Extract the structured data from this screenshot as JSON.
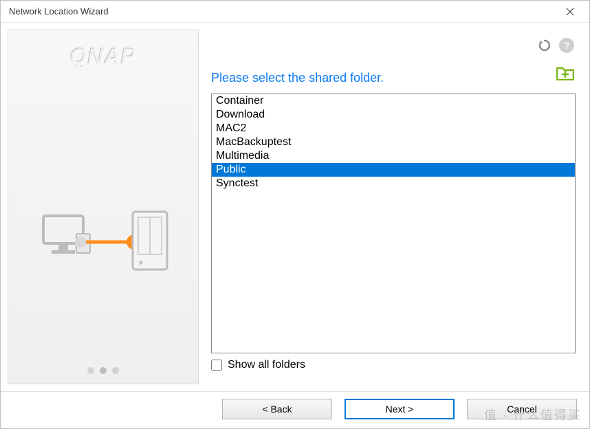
{
  "window": {
    "title": "Network Location Wizard"
  },
  "sidebar": {
    "brand": "QNAP",
    "progress": {
      "total": 3,
      "current": 2
    }
  },
  "main": {
    "instruction": "Please select the shared folder.",
    "refresh_icon": "refresh-icon",
    "help_icon": "help-icon",
    "add_folder_icon": "add-folder-icon",
    "folders": [
      {
        "name": "Container",
        "selected": false
      },
      {
        "name": "Download",
        "selected": false
      },
      {
        "name": "MAC2",
        "selected": false
      },
      {
        "name": "MacBackuptest",
        "selected": false
      },
      {
        "name": "Multimedia",
        "selected": false
      },
      {
        "name": "Public",
        "selected": true
      },
      {
        "name": "Synctest",
        "selected": false
      }
    ],
    "show_all_label": "Show all folders",
    "show_all_checked": false
  },
  "footer": {
    "back": "< Back",
    "next": "Next >",
    "cancel": "Cancel"
  },
  "watermark": "值 · 什么值得买"
}
